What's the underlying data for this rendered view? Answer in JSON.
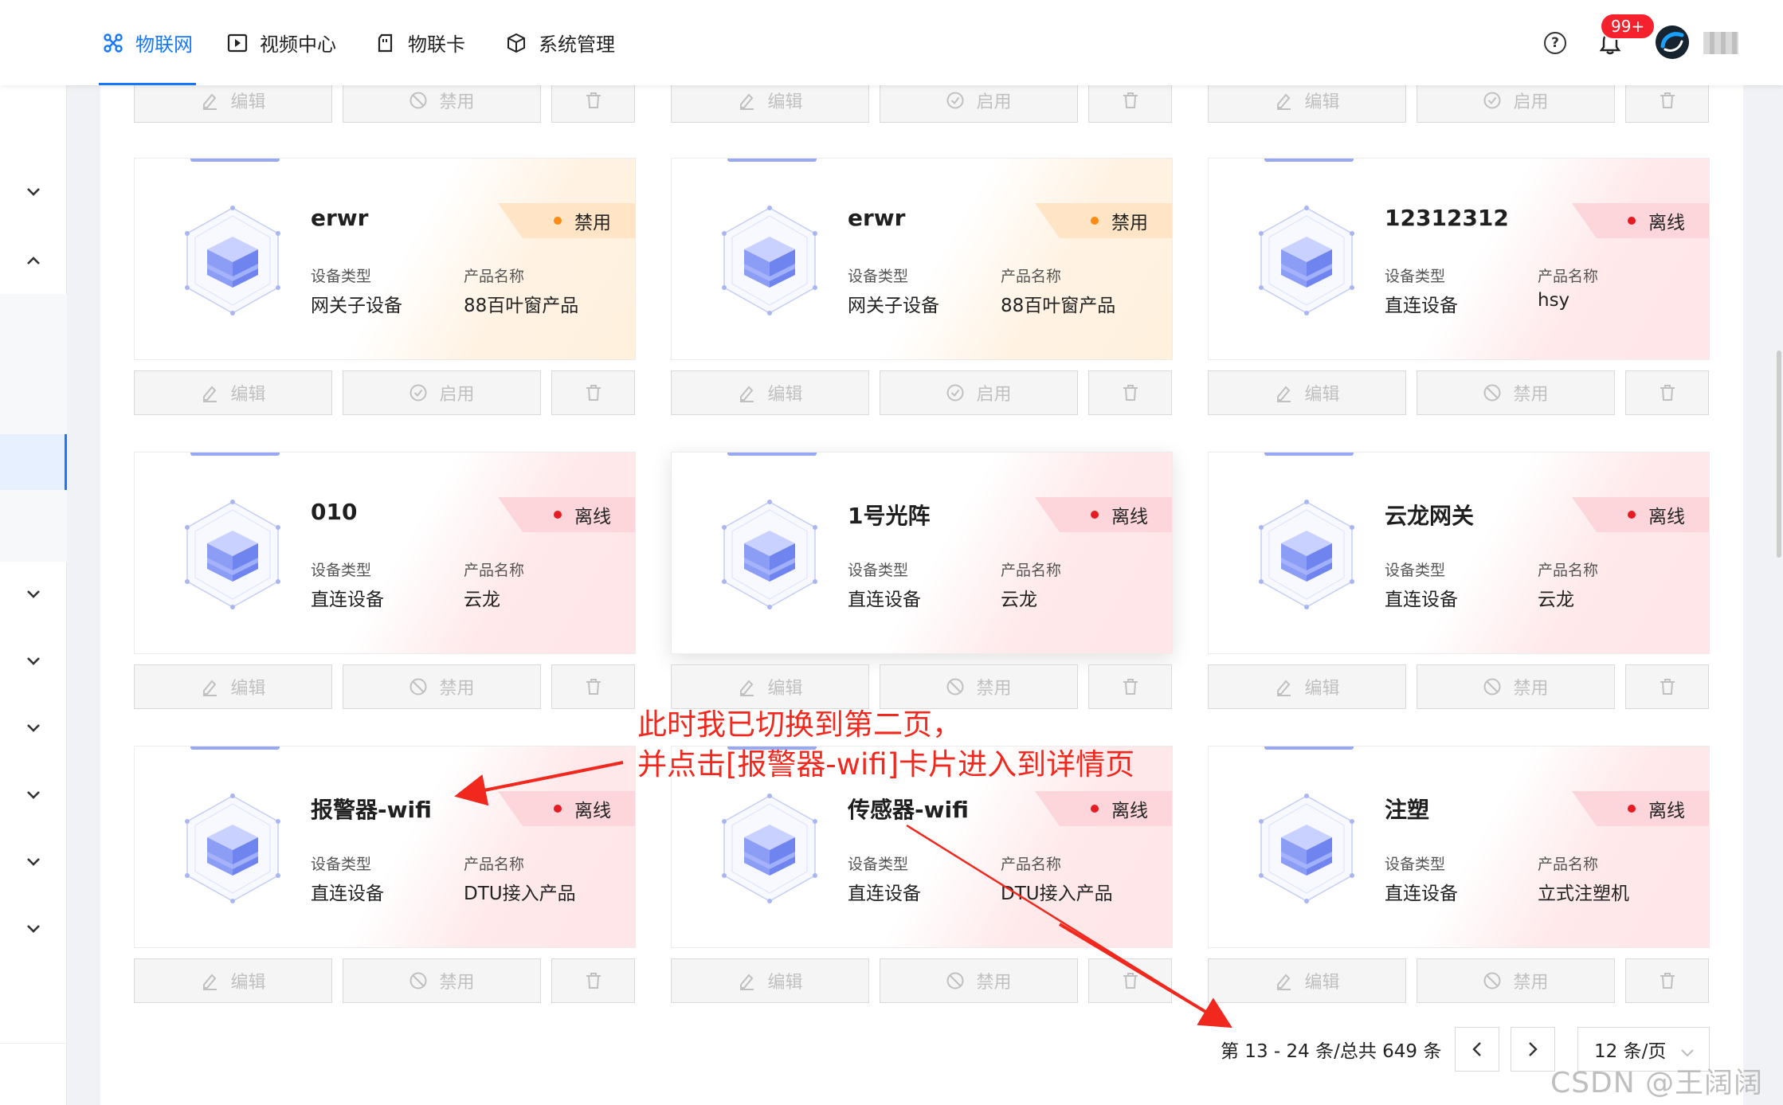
{
  "nav": {
    "tabs": [
      {
        "label": "物联网",
        "icon": "iot-icon",
        "active": true
      },
      {
        "label": "视频中心",
        "icon": "play-icon",
        "active": false
      },
      {
        "label": "物联卡",
        "icon": "sim-card-icon",
        "active": false
      },
      {
        "label": "系统管理",
        "icon": "cube-icon",
        "active": false
      }
    ],
    "notification_badge": "99+",
    "accent": "#1677ff"
  },
  "card_labels": {
    "device_type": "设备类型",
    "product_name": "产品名称"
  },
  "buttons": {
    "edit": "编辑",
    "disable": "禁用",
    "enable": "启用"
  },
  "top_partial_row": [
    "禁用",
    "启用",
    "启用"
  ],
  "devices": [
    {
      "name": "erwr",
      "status": "禁用",
      "status_color": "#fa8c16",
      "device_type": "网关子设备",
      "product": "88百叶窗产品",
      "action": "启用"
    },
    {
      "name": "erwr",
      "status": "禁用",
      "status_color": "#fa8c16",
      "device_type": "网关子设备",
      "product": "88百叶窗产品",
      "action": "启用"
    },
    {
      "name": "12312312",
      "status": "离线",
      "status_color": "#e51c23",
      "device_type": "直连设备",
      "product": "hsy",
      "action": "禁用"
    },
    {
      "name": "010",
      "status": "离线",
      "status_color": "#e51c23",
      "device_type": "直连设备",
      "product": "云龙",
      "action": "禁用"
    },
    {
      "name": "1号光阵",
      "status": "离线",
      "status_color": "#e51c23",
      "device_type": "直连设备",
      "product": "云龙",
      "action": "禁用"
    },
    {
      "name": "云龙网关",
      "status": "离线",
      "status_color": "#e51c23",
      "device_type": "直连设备",
      "product": "云龙",
      "action": "禁用"
    },
    {
      "name": "报警器-wifi",
      "status": "离线",
      "status_color": "#e51c23",
      "device_type": "直连设备",
      "product": "DTU接入产品",
      "action": "禁用"
    },
    {
      "name": "传感器-wifi",
      "status": "离线",
      "status_color": "#e51c23",
      "device_type": "直连设备",
      "product": "DTU接入产品",
      "action": "禁用"
    },
    {
      "name": "注塑",
      "status": "离线",
      "status_color": "#e51c23",
      "device_type": "直连设备",
      "product": "立式注塑机",
      "action": "禁用"
    }
  ],
  "pagination": {
    "info": "第 13 - 24 条/总共 649 条",
    "page_size": "12 条/页"
  },
  "annotation": {
    "line1": "此时我已切换到第二页，",
    "line2": "并点击[报警器-wifi]卡片进入到详情页",
    "color": "#f0281e"
  },
  "watermark": "CSDN @王阔阔"
}
